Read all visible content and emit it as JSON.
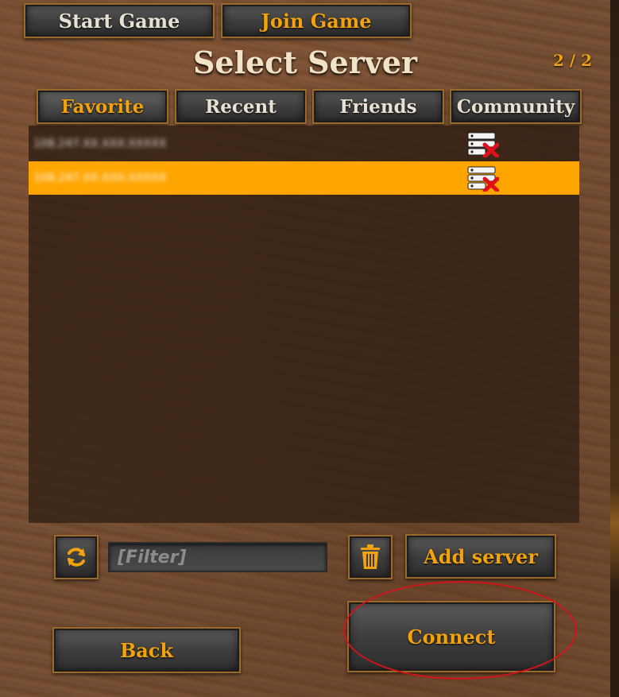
{
  "top_tabs": {
    "start_game": "Start Game",
    "join_game": "Join Game"
  },
  "header": {
    "title": "Select Server",
    "page_indicator": "2 / 2"
  },
  "list_tabs": {
    "favorite": "Favorite",
    "recent": "Recent",
    "friends": "Friends",
    "community": "Community"
  },
  "servers": [
    {
      "address": "108.247.XX.XXX:XXXXX",
      "status_icon": "server-offline-icon",
      "selected": false
    },
    {
      "address": "108.247.XX.XXX:XXXXX",
      "status_icon": "server-offline-icon",
      "selected": true
    }
  ],
  "controls": {
    "refresh_icon": "refresh-icon",
    "filter_placeholder": "[Filter]",
    "delete_icon": "trash-icon",
    "add_server": "Add server",
    "back": "Back",
    "connect": "Connect"
  },
  "colors": {
    "accent": "#f2a20c",
    "selection": "#ffa500",
    "highlight_circle": "#d2141a"
  }
}
